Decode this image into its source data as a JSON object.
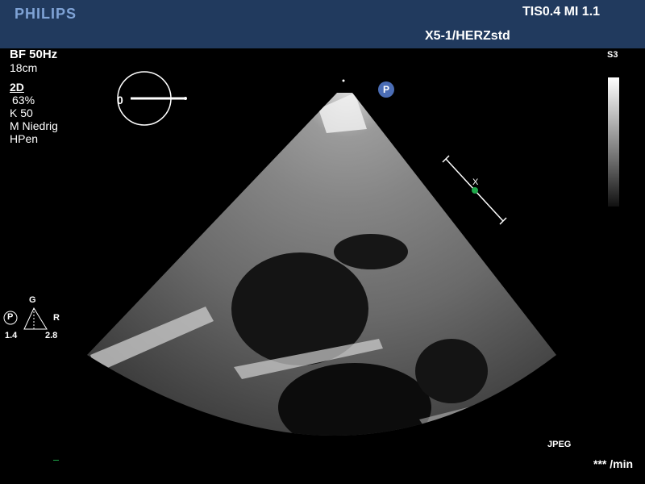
{
  "header": {
    "brand": "PHILIPS",
    "tis_mi": "TIS0.4   MI 1.1",
    "probe_preset": "X5-1/HERZstd"
  },
  "params": {
    "frame_rate": "BF 50Hz",
    "depth": "18cm",
    "mode": "2D",
    "gain": "63%",
    "compress": "K 50",
    "motion": "M Niedrig",
    "harmonics": "HPen"
  },
  "grayscale": {
    "label": "S3"
  },
  "orientation": {
    "angle_label": "0"
  },
  "probe_badge": "P",
  "focus": {
    "badge": "P",
    "top": "G",
    "right": "R",
    "left_value": "1.4",
    "right_value": "2.8"
  },
  "footer": {
    "format": "JPEG",
    "heart_rate": "*** /min"
  },
  "caliper": {
    "marker": "X"
  },
  "colors": {
    "header_bg": "#213a5e",
    "brand": "#7fa3d6",
    "badge": "#4b6db5",
    "caliper_dot": "#1ea84a"
  }
}
